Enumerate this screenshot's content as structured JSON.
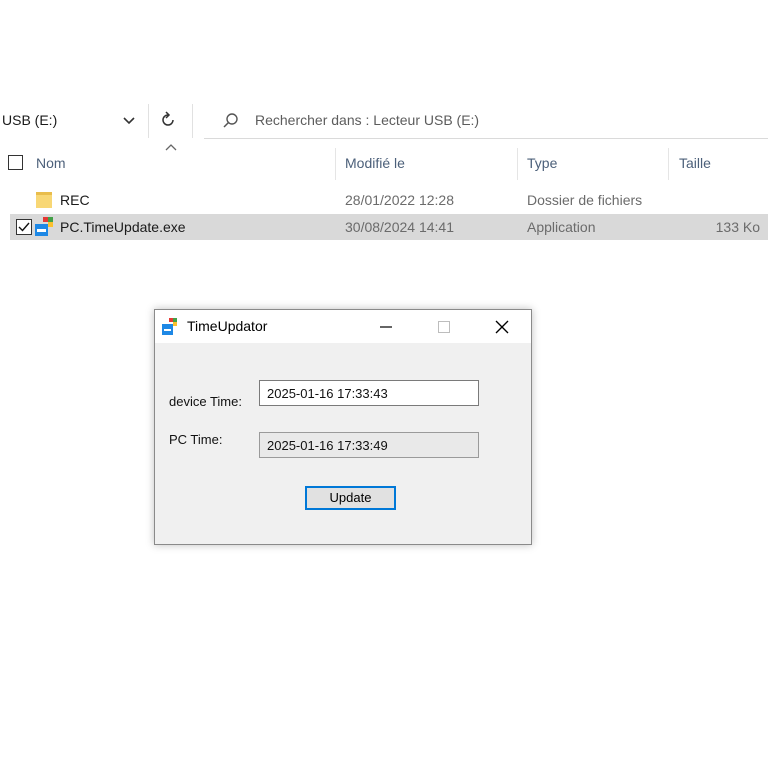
{
  "explorer": {
    "address": "USB (E:)",
    "search_placeholder": "Rechercher dans : Lecteur USB (E:)",
    "columns": {
      "name": "Nom",
      "modified": "Modifié le",
      "type": "Type",
      "size": "Taille"
    },
    "files": [
      {
        "name": "REC",
        "modified": "28/01/2022 12:28",
        "type": "Dossier de fichiers",
        "size": "",
        "icon": "folder-icon",
        "selected": false
      },
      {
        "name": "PC.TimeUpdate.exe",
        "modified": "30/08/2024 14:41",
        "type": "Application",
        "size": "133 Ko",
        "icon": "app-icon",
        "selected": true
      }
    ]
  },
  "dialog": {
    "title": "TimeUpdator",
    "device_time_label": "device Time:",
    "device_time_value": "2025-01-16 17:33:43",
    "pc_time_label": "PC Time:",
    "pc_time_value": "2025-01-16 17:33:49",
    "update_label": "Update"
  },
  "colors": {
    "accent": "#0078d7",
    "selection": "#d9d9d9",
    "header_text": "#4c607a",
    "folder": "#f8d775"
  }
}
